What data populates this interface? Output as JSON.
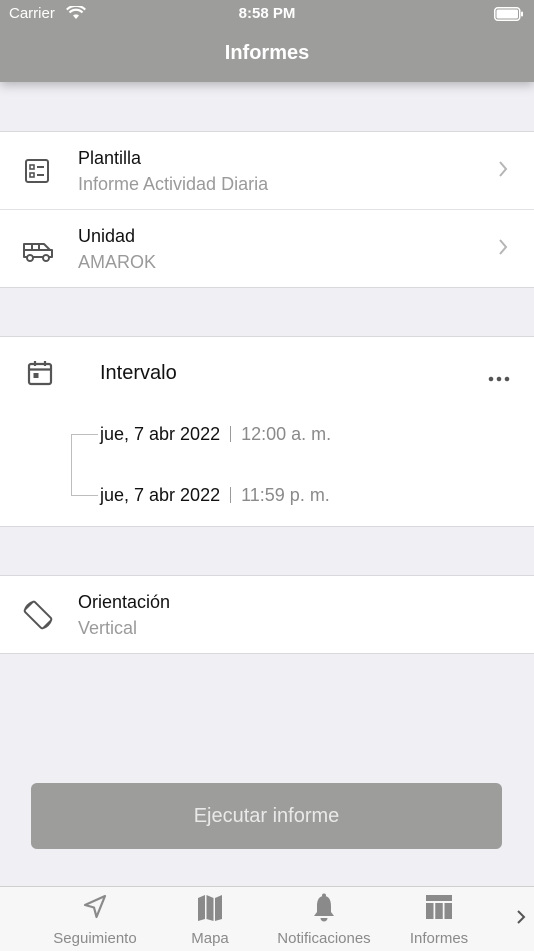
{
  "status_bar": {
    "carrier": "Carrier",
    "time": "8:58 PM"
  },
  "header": {
    "title": "Informes"
  },
  "template": {
    "label": "Plantilla",
    "value": "Informe Actividad Diaria",
    "icon": "template-icon"
  },
  "unit": {
    "label": "Unidad",
    "value": "AMAROK",
    "icon": "van-icon"
  },
  "interval": {
    "label": "Intervalo",
    "icon": "calendar-icon",
    "start": {
      "date": "jue, 7 abr 2022",
      "time": "12:00 a. m."
    },
    "end": {
      "date": "jue, 7 abr 2022",
      "time": "11:59 p. m."
    }
  },
  "orientation": {
    "label": "Orientación",
    "value": "Vertical",
    "icon": "rotate-icon"
  },
  "run_button": {
    "label": "Ejecutar informe"
  },
  "tabs": [
    {
      "label": "Seguimiento",
      "icon": "navigation-arrow-icon"
    },
    {
      "label": "Mapa",
      "icon": "map-icon"
    },
    {
      "label": "Notificaciones",
      "icon": "bell-icon"
    },
    {
      "label": "Informes",
      "icon": "table-icon"
    }
  ],
  "colors": {
    "accent": "#9d9d9b",
    "background": "#efeff4",
    "secondary_text": "#9a9a9a"
  }
}
